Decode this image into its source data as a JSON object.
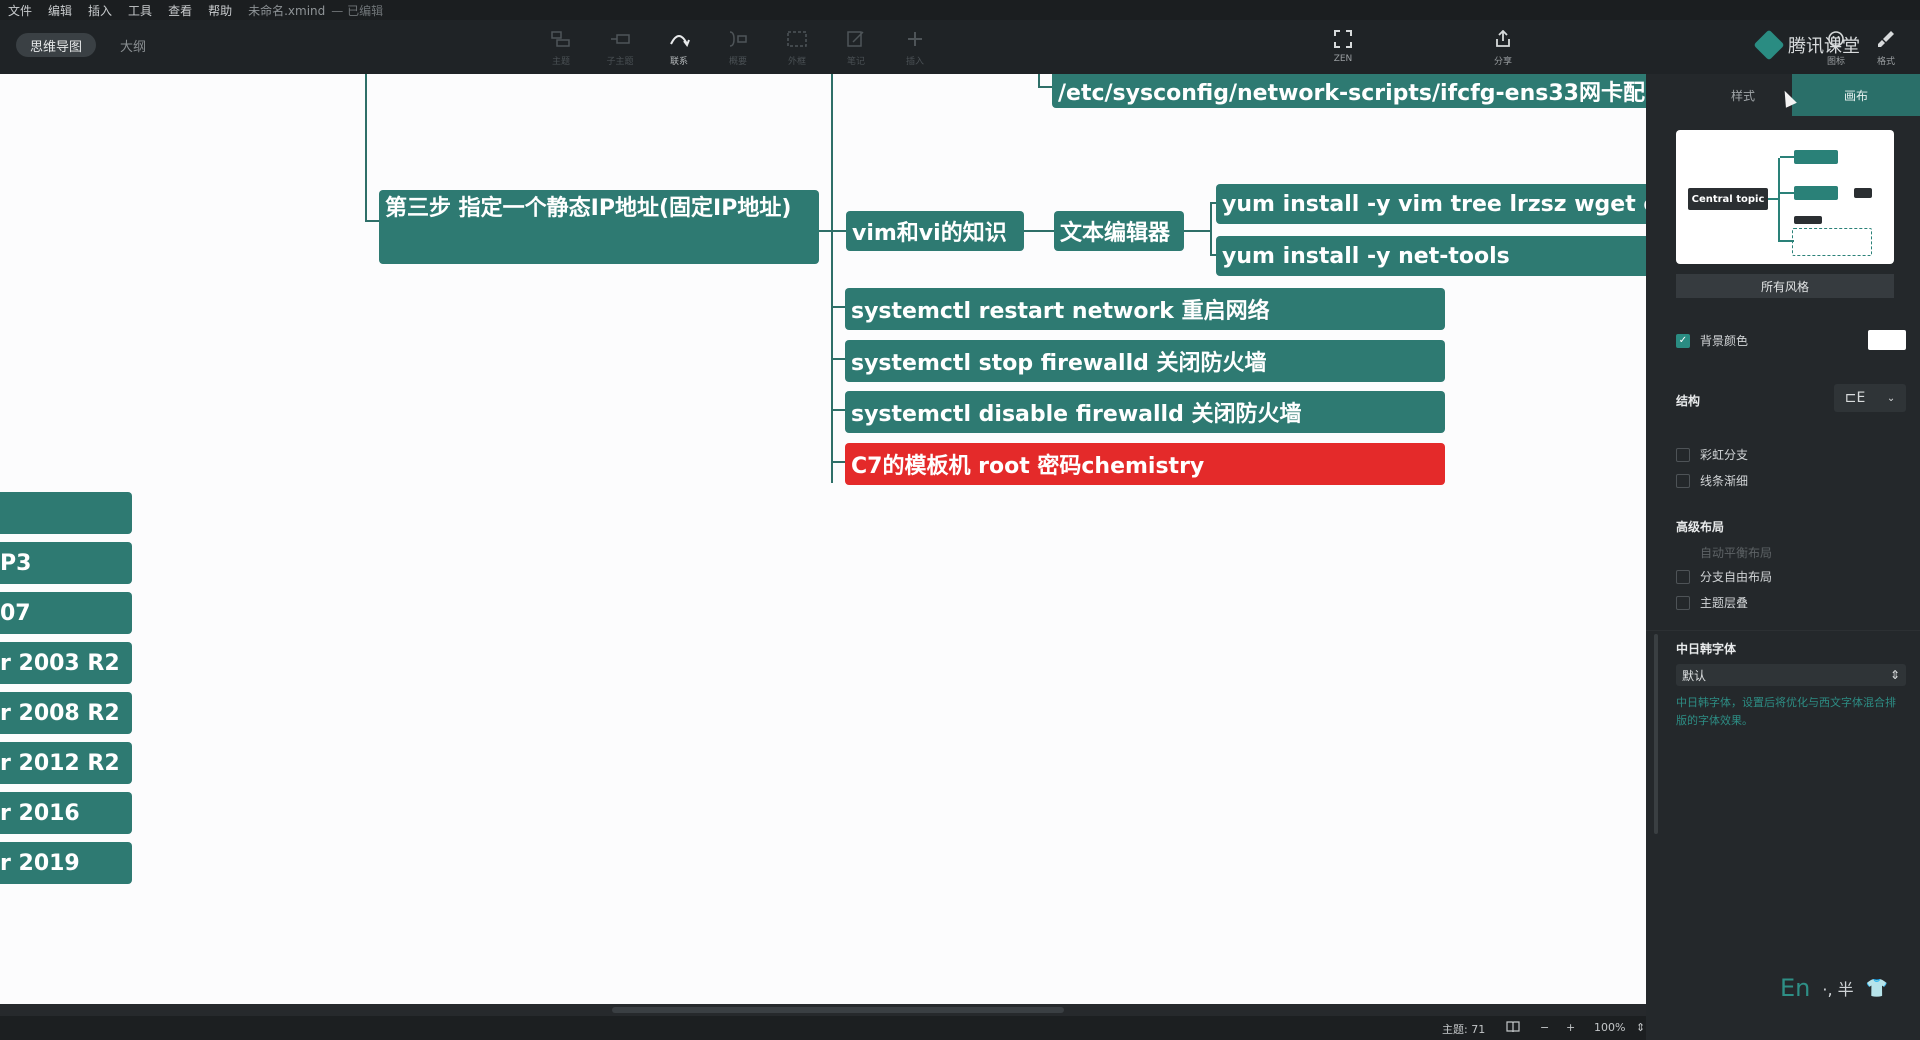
{
  "menubar": {
    "items": [
      "文件",
      "编辑",
      "插入",
      "工具",
      "查看",
      "帮助"
    ],
    "document": "未命名.xmind",
    "state": "— 已编辑"
  },
  "toolbar": {
    "mode_mindmap": "思维导图",
    "mode_outline": "大纲",
    "tools": [
      {
        "label": "主题",
        "icon": "topic-icon"
      },
      {
        "label": "子主题",
        "icon": "subtopic-icon"
      },
      {
        "label": "联系",
        "icon": "relationship-icon"
      },
      {
        "label": "概要",
        "icon": "summary-icon"
      },
      {
        "label": "外框",
        "icon": "boundary-icon"
      },
      {
        "label": "笔记",
        "icon": "note-icon"
      },
      {
        "label": "插入",
        "icon": "insert-icon"
      }
    ],
    "zen": "ZEN",
    "share": "分享",
    "icons_label": "图标",
    "format_label": "格式"
  },
  "brand": "腾讯课堂",
  "mindmap": {
    "ifcfg_node": "/etc/sysconfig/network-scripts/ifcfg-ens33网卡配",
    "step3_node": "第三步 指定一个静态IP地址(固定IP地址)",
    "vim_node": "vim和vi的知识",
    "editor_node": "文本编辑器",
    "yum_vim_node": "yum install -y vim  tree lrzsz wget c",
    "yum_net_node": "yum install -y net-tools",
    "restart_node": "systemctl restart network  重启网络",
    "stop_node": "systemctl stop firewalld 关闭防火墙",
    "disable_node": "systemctl disable firewalld 关闭防火墙",
    "template_node": "C7的模板机 root  密码chemistry",
    "left_nodes": [
      "",
      "P3",
      "07",
      "r 2003 R2",
      "r 2008 R2",
      "r 2012 R2",
      "r 2016",
      "r 2019"
    ]
  },
  "statusbar": {
    "topics": "主题: 71",
    "zoom": "100%"
  },
  "panel": {
    "tab_style": "样式",
    "tab_canvas": "画布",
    "preview_central": "Central topic",
    "all_styles": "所有风格",
    "bg_color": "背景颜色",
    "structure": "结构",
    "rainbow": "彩虹分支",
    "taper": "线条渐细",
    "advanced": "高级布局",
    "auto_balance": "自动平衡布局",
    "free_layout": "分支自由布局",
    "overlap": "主题层叠",
    "cjk_font": "中日韩字体",
    "font_default": "默认",
    "font_note": "中日韩字体，设置后将优化与西文字体混合排版的字体效果。"
  },
  "colors": {
    "node": "#2e7a72",
    "node_red": "#e42a2a",
    "accent": "#2a8c82"
  }
}
